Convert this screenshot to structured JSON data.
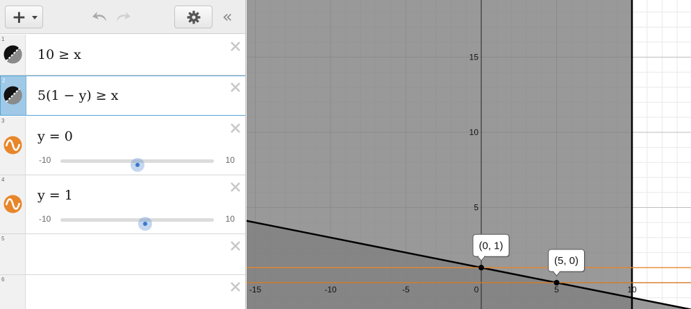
{
  "toolbar": {
    "add_label": "+"
  },
  "expressions": [
    {
      "index": "1",
      "latex": "10 ≥ x",
      "icon": "inequality-icon"
    },
    {
      "index": "2",
      "latex": "5(1 − y) ≥ x",
      "icon": "inequality-icon"
    },
    {
      "index": "3",
      "latex": "y = 0",
      "icon": "wave-icon",
      "slider": {
        "min": "-10",
        "max": "10",
        "value": 0
      }
    },
    {
      "index": "4",
      "latex": "y = 1",
      "icon": "wave-icon",
      "slider": {
        "min": "-10",
        "max": "10",
        "value": 1
      }
    },
    {
      "index": "5",
      "latex": ""
    },
    {
      "index": "6",
      "latex": ""
    }
  ],
  "graph": {
    "x_ticks": [
      "-15",
      "-10",
      "-5",
      "0",
      "5",
      "10"
    ],
    "y_ticks": [
      "5",
      "10",
      "15"
    ],
    "points": [
      {
        "label": "(0, 1)",
        "x": 0,
        "y": 1
      },
      {
        "label": "(5, 0)",
        "x": 5,
        "y": 0
      }
    ],
    "colors": {
      "shade": "#808080",
      "line": "#000000",
      "horizontal": "#e8862a"
    }
  }
}
